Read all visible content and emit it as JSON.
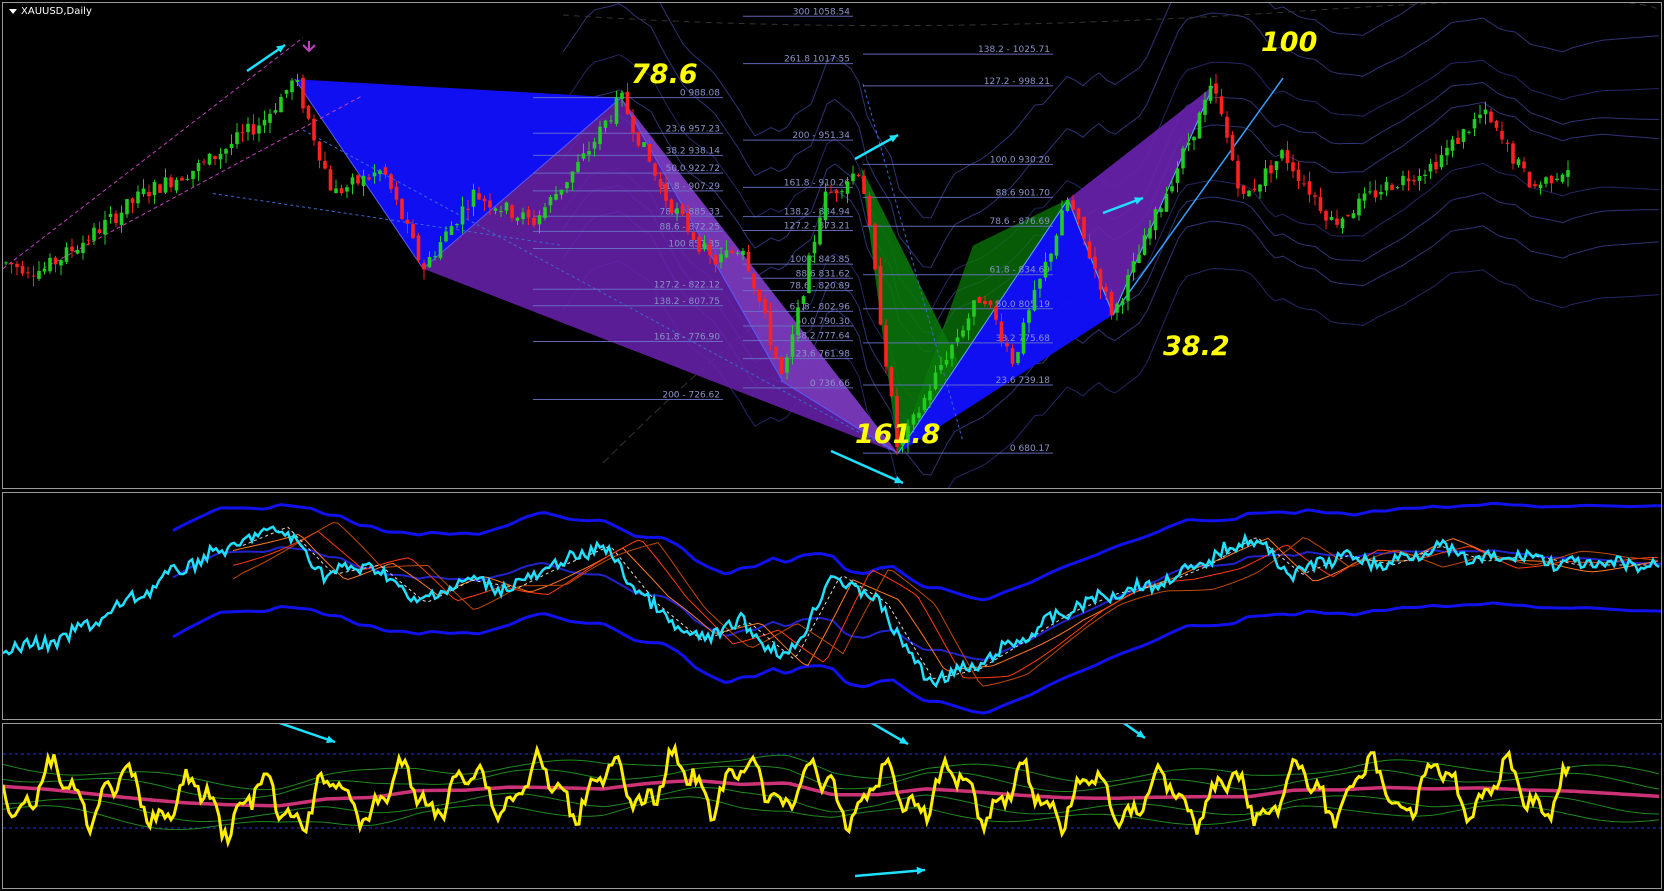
{
  "window": {
    "symbol_title": "XAUUSD,Daily"
  },
  "colors": {
    "background": "#000000",
    "candle_up": "#22cc22",
    "candle_down": "#ff2020",
    "pattern_blue": "#1010ff",
    "pattern_purple": "#6a22b0",
    "pattern_green": "#0a7a0a",
    "fib_lines": "#6a72c8",
    "annotation": "#ffff00",
    "arrows": "#1ee0ff",
    "osc_main": "#22e0ff",
    "osc_band": "#1111ee",
    "osc2_main": "#ffee00",
    "osc2_signal": "#cc3377"
  },
  "chart_data": [
    {
      "type": "candlestick",
      "title": "XAUUSD,Daily",
      "pattern_annotations": [
        "78.6",
        "161.8",
        "100",
        "38.2"
      ],
      "fib_labels": [
        "300 1058.54",
        "261.8 1017.55",
        "200 - 951.34",
        "161.8 - 910.26",
        "138.2 - 884.94",
        "127.2 - 873.21",
        "100.0 843.85",
        "88.6 831.62",
        "78.6 - 820.89",
        "61.8 - 802.96",
        "50.0 790.30",
        "38.2 777.64",
        "23.6 761.98",
        "0 736.66",
        "200 - 726.62",
        "0 988.08",
        "23.6 957.23",
        "38.2 938.14",
        "50.0 922.72",
        "61.8 - 907.29",
        "78.6 - 885.33",
        "88.6 - 872.25",
        "100 857.35",
        "127.2 - 822.12",
        "138.2 - 807.75",
        "161.8 - 776.90",
        "138.2 - 1025.71",
        "127.2 - 998.21",
        "100.0 930.20",
        "88.6 901.70",
        "78.6 - 876.69",
        "61.8 - 834.69",
        "50.0 805.19",
        "38.2 775.68",
        "23.6 739.18",
        "0 680.17"
      ],
      "price_path_approx": [
        {
          "x": 0,
          "y": 845
        },
        {
          "x": 40,
          "y": 838
        },
        {
          "x": 90,
          "y": 870
        },
        {
          "x": 140,
          "y": 905
        },
        {
          "x": 200,
          "y": 930
        },
        {
          "x": 260,
          "y": 968
        },
        {
          "x": 292,
          "y": 1004
        },
        {
          "x": 330,
          "y": 905
        },
        {
          "x": 380,
          "y": 925
        },
        {
          "x": 420,
          "y": 840
        },
        {
          "x": 470,
          "y": 905
        },
        {
          "x": 530,
          "y": 880
        },
        {
          "x": 580,
          "y": 935
        },
        {
          "x": 618,
          "y": 988
        },
        {
          "x": 660,
          "y": 905
        },
        {
          "x": 710,
          "y": 845
        },
        {
          "x": 740,
          "y": 860
        },
        {
          "x": 780,
          "y": 742
        },
        {
          "x": 820,
          "y": 900
        },
        {
          "x": 858,
          "y": 928
        },
        {
          "x": 895,
          "y": 680
        },
        {
          "x": 940,
          "y": 760
        },
        {
          "x": 980,
          "y": 820
        },
        {
          "x": 1010,
          "y": 760
        },
        {
          "x": 1065,
          "y": 900
        },
        {
          "x": 1110,
          "y": 800
        },
        {
          "x": 1160,
          "y": 900
        },
        {
          "x": 1210,
          "y": 998
        },
        {
          "x": 1240,
          "y": 900
        },
        {
          "x": 1280,
          "y": 940
        },
        {
          "x": 1330,
          "y": 880
        },
        {
          "x": 1380,
          "y": 910
        },
        {
          "x": 1430,
          "y": 930
        },
        {
          "x": 1480,
          "y": 975
        },
        {
          "x": 1530,
          "y": 910
        },
        {
          "x": 1568,
          "y": 930
        }
      ]
    },
    {
      "type": "line",
      "series": [
        {
          "name": "",
          "role": "main",
          "values_norm": [
            0.73,
            0.72,
            0.6,
            0.45,
            0.3,
            0.2,
            0.1,
            0.35,
            0.3,
            0.5,
            0.38,
            0.42,
            0.3,
            0.2,
            0.5,
            0.7,
            0.6,
            0.8,
            0.35,
            0.5,
            0.9,
            0.85,
            0.7,
            0.55,
            0.45,
            0.4,
            0.3,
            0.15,
            0.35,
            0.25,
            0.3,
            0.2,
            0.28,
            0.25,
            0.3
          ]
        }
      ]
    },
    {
      "type": "line",
      "series": [
        {
          "name": "",
          "role": "main",
          "level_lines": [
            "upper",
            "lower"
          ]
        }
      ]
    }
  ]
}
